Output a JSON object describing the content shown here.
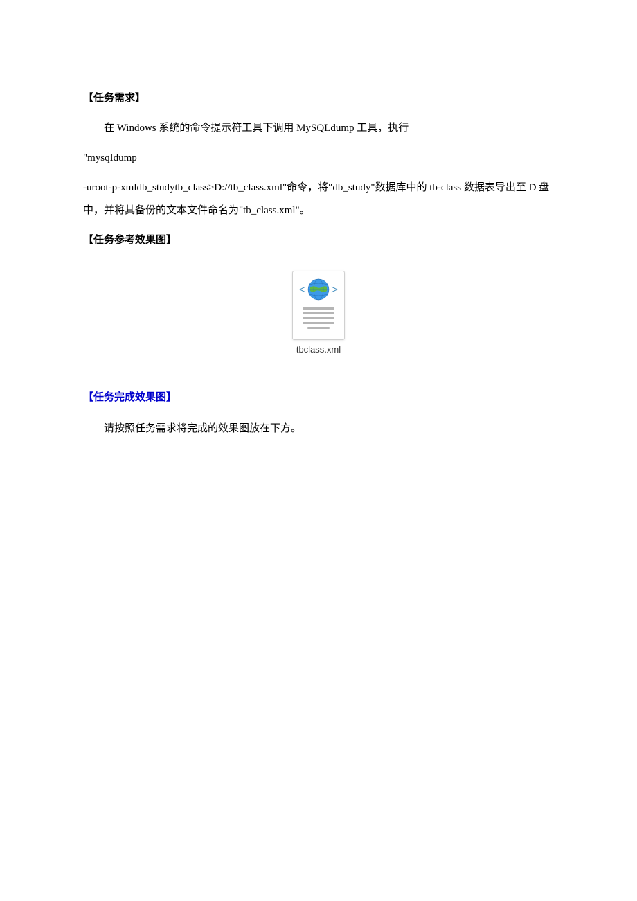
{
  "headers": {
    "task_requirement": "【任务需求】",
    "task_reference_result": "【任务参考效果图】",
    "task_completion_result": "【任务完成效果图】"
  },
  "content": {
    "line1": "在 Windows 系统的命令提示符工具下调用 MySQLdump 工具，执行",
    "line2": "\"mysqIdump",
    "line3": "-uroot-p-xmldb_studytb_class>D://tb_class.xml\"命令，将″db_study\"数据库中的 tb-class 数据表导出至 D 盘中，并将其备份的文本文件命名为\"tb_class.xml\"。",
    "completion_instruction": "请按照任务需求将完成的效果图放在下方。"
  },
  "file": {
    "name": "tbclass.xml"
  }
}
